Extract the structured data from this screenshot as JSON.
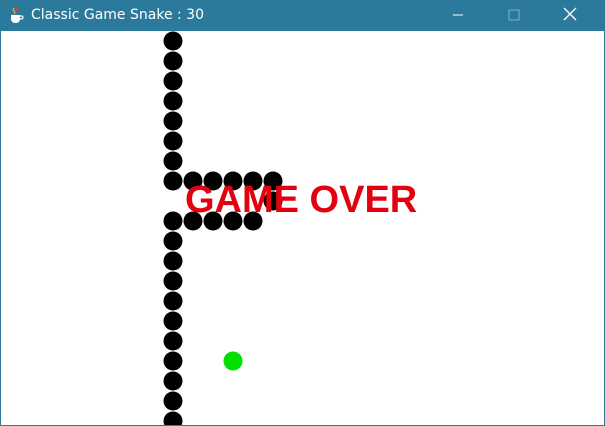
{
  "window": {
    "title": "Classic Game Snake : 30",
    "titlebar_color": "#2b7a9b",
    "app_icon": "java-cup-icon",
    "controls": {
      "minimize_icon": "minimize-icon",
      "maximize_icon": "maximize-icon",
      "close_icon": "close-icon"
    }
  },
  "game": {
    "message": "GAME OVER",
    "message_color": "#e3000f",
    "snake_color": "#000000",
    "food_color": "#00e000",
    "background": "#ffffff"
  }
}
